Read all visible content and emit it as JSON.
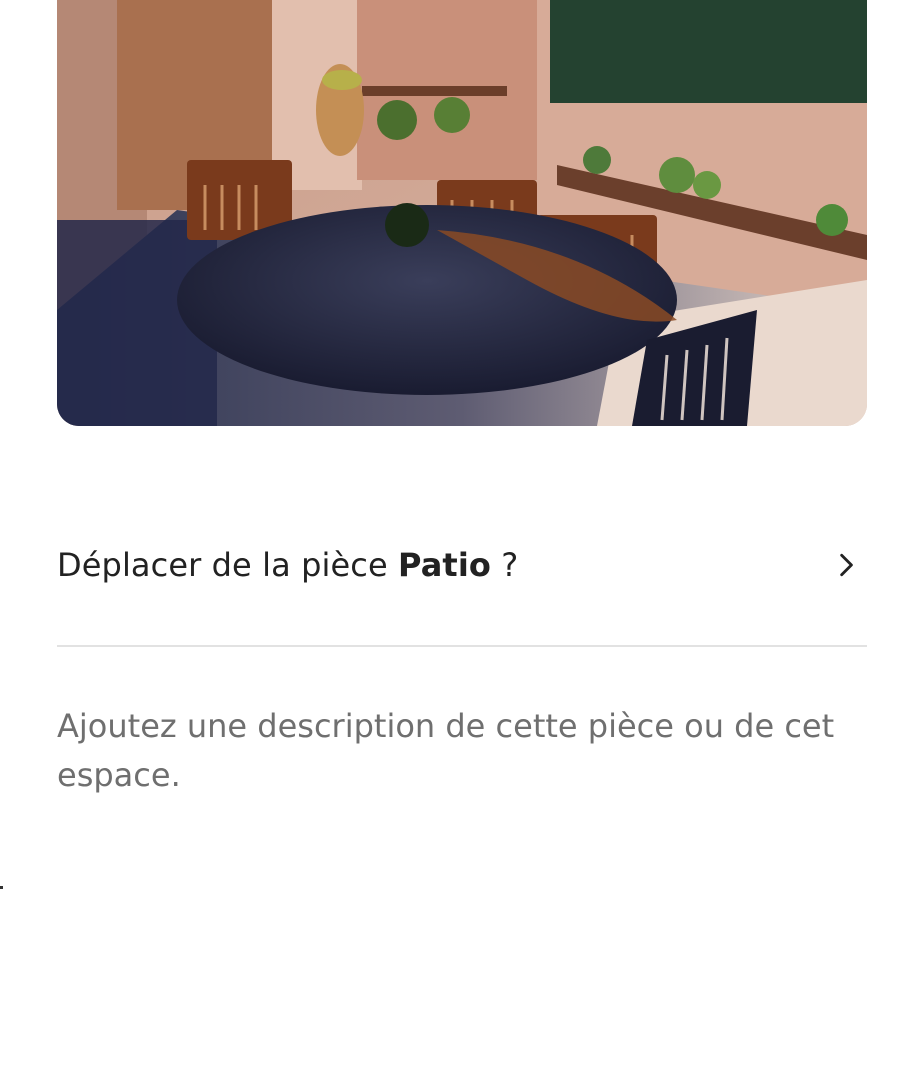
{
  "room_photo": {
    "icon": "patio-photo",
    "alt": "Patio"
  },
  "move_room": {
    "prefix": "Déplacer de la pièce",
    "room_name": "Patio",
    "suffix": "?",
    "icon": "chevron-right-icon"
  },
  "description": {
    "placeholder": "Ajoutez une description de cette pièce ou de cet espace."
  },
  "colors": {
    "text_primary": "#222222",
    "text_secondary": "#6f6f6f",
    "divider": "#e2e2e2",
    "background": "#ffffff"
  }
}
